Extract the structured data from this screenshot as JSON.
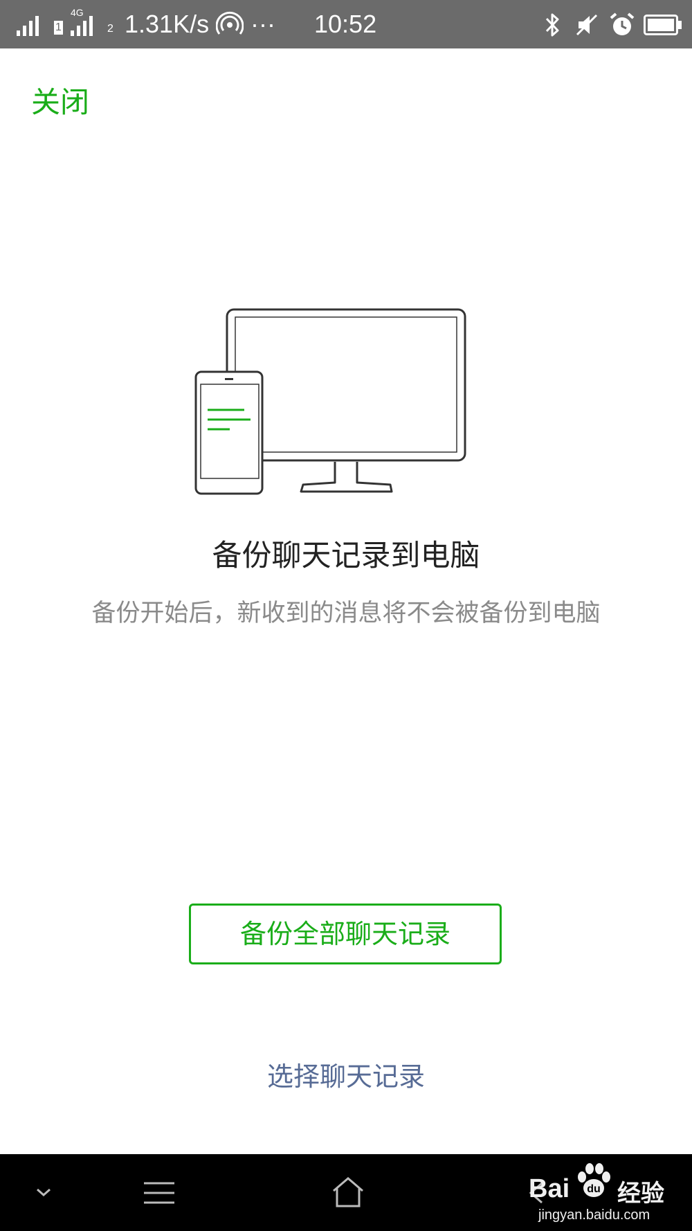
{
  "status_bar": {
    "sim1_label": "1",
    "network_type": "4G",
    "sim2_label": "2",
    "speed": "1.31K/s",
    "more": "···",
    "time": "10:52",
    "icons": [
      "signal-icon",
      "hotspot-icon",
      "bluetooth-icon",
      "mute-icon",
      "alarm-icon",
      "battery-icon"
    ]
  },
  "header": {
    "close_label": "关闭"
  },
  "illustration": {
    "icon": "phone-to-monitor-icon",
    "accent_color": "#1aad19"
  },
  "content": {
    "title": "备份聊天记录到电脑",
    "subtitle": "备份开始后，新收到的消息将不会被备份到电脑"
  },
  "actions": {
    "backup_all_label": "备份全部聊天记录",
    "select_label": "选择聊天记录"
  },
  "nav_bar": {
    "icons": [
      "chevron-down-icon",
      "menu-icon",
      "home-icon",
      "back-icon"
    ]
  },
  "watermark": {
    "brand_left": "Bai",
    "brand_right": "经验",
    "url": "jingyan.baidu.com"
  },
  "colors": {
    "accent": "#1aad19",
    "link": "#576b95",
    "status_bar_bg": "#6b6b6b",
    "nav_bar_bg": "#000000"
  }
}
